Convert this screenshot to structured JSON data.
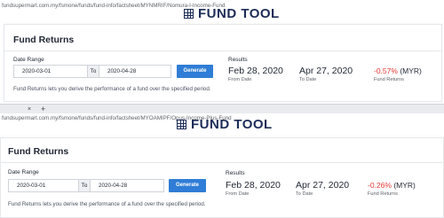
{
  "top_window": {
    "url": "fundsupermart.com.my/fsmone/funds/fund-info/factsheet/MYNMRIF/Nomura-I-Income-Fund",
    "tool_title": "FUND TOOL",
    "card_title": "Fund Returns",
    "date_range_label": "Date Range",
    "from_date": "2020-03-01",
    "to_label": "To",
    "to_date": "2020-04-28",
    "generate_label": "Generate",
    "description": "Fund Returns lets you derive the performance of a fund over the specified period.",
    "results_label": "Results",
    "result_from_date": "Feb 28, 2020",
    "result_from_caption": "From Date",
    "result_to_date": "Apr 27, 2020",
    "result_to_caption": "To Date",
    "fund_return_value": "-0.57%",
    "fund_return_currency": "(MYR)",
    "fund_return_caption": "Fund Returns"
  },
  "tab_bar": {
    "close_glyph": "×",
    "new_tab_glyph": "+"
  },
  "bottom_window": {
    "url": "fundsupermart.com.my/fsmone/funds/fund-info/factsheet/MYOAMIPF/Opus-Income-Plus-Fund",
    "tool_title": "FUND TOOL",
    "card_title": "Fund Returns",
    "date_range_label": "Date Range",
    "from_date": "2020-03-01",
    "to_label": "To",
    "to_date": "2020-04-28",
    "generate_label": "Generate",
    "description": "Fund Returns lets you derive the performance of a fund over the specified period.",
    "results_label": "Results",
    "result_from_date": "Feb 28, 2020",
    "result_from_caption": "From Date",
    "result_to_date": "Apr 27, 2020",
    "result_to_caption": "To Date",
    "fund_return_value": "-0.26%",
    "fund_return_currency": "(MYR)",
    "fund_return_caption": "Fund Returns"
  },
  "colors": {
    "negative_return": "#e53935",
    "generate_button": "#2f7dd6",
    "title_navy": "#1d2c57"
  },
  "icons": [
    "calculator-icon"
  ]
}
